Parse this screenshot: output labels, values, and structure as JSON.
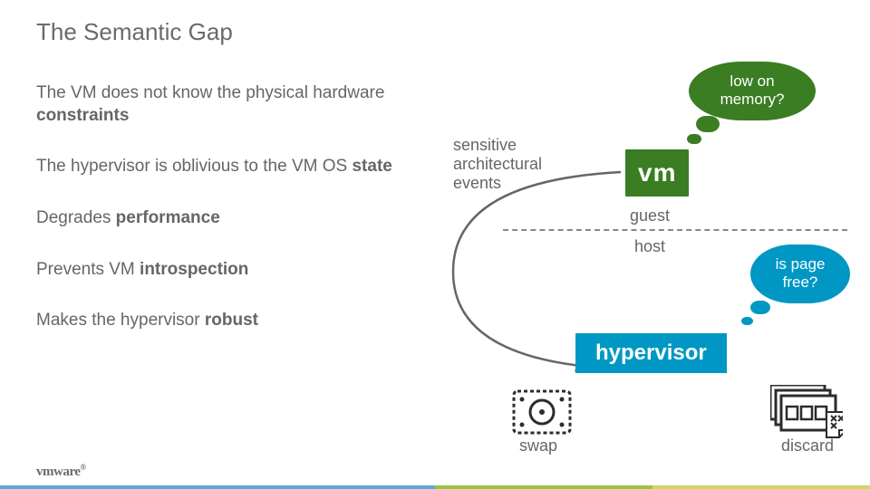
{
  "title": "The Semantic Gap",
  "bullets": [
    {
      "pre": "The VM does not know the physical hardware ",
      "bold": "constraints"
    },
    {
      "pre": "The hypervisor is oblivious to the VM OS ",
      "bold": "state"
    },
    {
      "pre": "Degrades ",
      "bold": "performance"
    },
    {
      "pre": "Prevents VM ",
      "bold": "introspection"
    },
    {
      "pre": "Makes the hypervisor ",
      "bold": "robust"
    }
  ],
  "diagram": {
    "cloud_green": "low on\nmemory?",
    "cloud_blue": "is page\nfree?",
    "vm_label": "vm",
    "hv_label": "hypervisor",
    "sensitive": "sensitive\narchitectural\nevents",
    "guest": "guest",
    "host": "host",
    "swap": "swap",
    "discard": "discard"
  },
  "logo": "vmware"
}
